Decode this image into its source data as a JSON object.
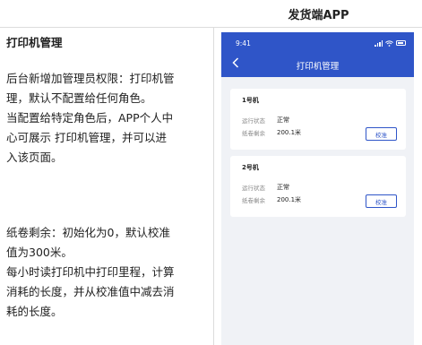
{
  "header": {
    "column_title": "发货端APP"
  },
  "spec": {
    "title": "打印机管理",
    "para1": [
      "后台新增加管理员权限：打印机管",
      "理，默认不配置给任何角色。",
      "当配置给特定角色后，APP个人中",
      "心可展示 打印机管理，并可以进",
      "入该页面。"
    ],
    "para2": [
      "纸卷剩余：初始化为0，默认校准",
      "值为300米。",
      "每小时读打印机中打印里程，计算",
      "消耗的长度，并从校准值中减去消",
      "耗的长度。"
    ]
  },
  "phone": {
    "status_time": "9:41",
    "nav_title": "打印机管理",
    "back_icon": "chevron-left-icon",
    "printers": [
      {
        "name": "1号机",
        "status_label": "运行状态",
        "status_value": "正常",
        "paper_label": "纸卷剩余",
        "paper_value": "200.1米",
        "calibrate_label": "校准"
      },
      {
        "name": "2号机",
        "status_label": "运行状态",
        "status_value": "正常",
        "paper_label": "纸卷剩余",
        "paper_value": "200.1米",
        "calibrate_label": "校准"
      }
    ]
  },
  "colors": {
    "brand": "#2f55c8",
    "page_bg": "#f0f2f6"
  }
}
